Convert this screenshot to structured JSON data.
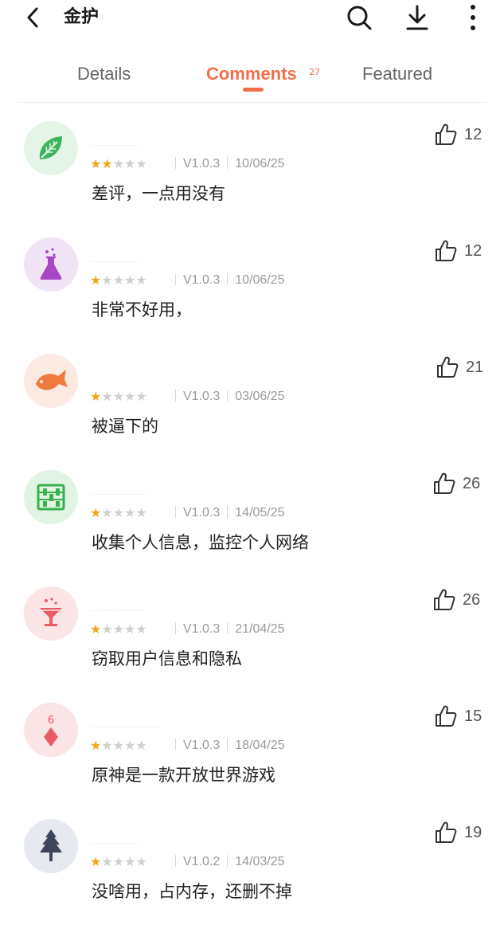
{
  "app": {
    "title": "金护"
  },
  "tabs": [
    {
      "label": "Details"
    },
    {
      "label": "Comments",
      "count": "27",
      "active": true
    },
    {
      "label": "Featured"
    }
  ],
  "colors": {
    "accent": "#f26f4c",
    "star": "#f3a51d",
    "star_empty": "#cfcfcf"
  },
  "comments": [
    {
      "avatar_icon": "leaf-icon",
      "rating": 2,
      "version": "V1.0.3",
      "date": "10/06/25",
      "text": "差评，一点用没有",
      "likes": "12"
    },
    {
      "avatar_icon": "flask-icon",
      "rating": 1,
      "version": "V1.0.3",
      "date": "10/06/25",
      "text": "非常不好用，",
      "likes": "12"
    },
    {
      "avatar_icon": "fish-icon",
      "rating": 1,
      "version": "V1.0.3",
      "date": "03/06/25",
      "text": "被逼下的",
      "likes": "21"
    },
    {
      "avatar_icon": "abacus-icon",
      "rating": 1,
      "version": "V1.0.3",
      "date": "14/05/25",
      "text": "收集个人信息，监控个人网络",
      "likes": "26"
    },
    {
      "avatar_icon": "cocktail-icon",
      "rating": 1,
      "version": "V1.0.3",
      "date": "21/04/25",
      "text": "窃取用户信息和隐私",
      "likes": "26"
    },
    {
      "avatar_icon": "diamond-card-icon",
      "rating": 1,
      "version": "V1.0.3",
      "date": "18/04/25",
      "text": "原神是一款开放世界游戏",
      "likes": "15"
    },
    {
      "avatar_icon": "pine-tree-icon",
      "rating": 1,
      "version": "V1.0.2",
      "date": "14/03/25",
      "text": "没啥用，占内存，还删不掉",
      "likes": "19"
    }
  ]
}
